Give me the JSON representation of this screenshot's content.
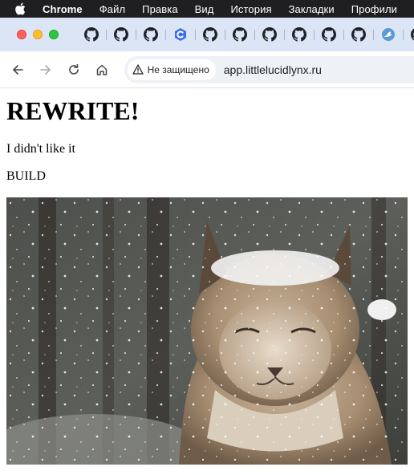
{
  "menubar": {
    "items": [
      "Chrome",
      "Файл",
      "Правка",
      "Вид",
      "История",
      "Закладки",
      "Профили"
    ]
  },
  "tabs": [
    {
      "icon": "github-icon"
    },
    {
      "icon": "github-icon"
    },
    {
      "icon": "github-icon"
    },
    {
      "icon": "circle-c-icon"
    },
    {
      "icon": "github-icon"
    },
    {
      "icon": "github-icon"
    },
    {
      "icon": "github-icon"
    },
    {
      "icon": "github-icon"
    },
    {
      "icon": "github-icon"
    },
    {
      "icon": "github-icon"
    },
    {
      "icon": "blue-bird-icon"
    },
    {
      "icon": "github-icon"
    }
  ],
  "toolbar": {
    "security_label": "Не защищено",
    "url": "app.littlelucidlynx.ru"
  },
  "page": {
    "heading": "REWRITE!",
    "paragraph1": "I didn't like it",
    "paragraph2": "BUILD",
    "image_description": "lynx in snow"
  },
  "colors": {
    "menubar_bg": "#1f1f22",
    "tabstrip_bg": "#dce5f5",
    "omnibox_bg": "#eef1f6",
    "accent": "#1a73e8"
  }
}
